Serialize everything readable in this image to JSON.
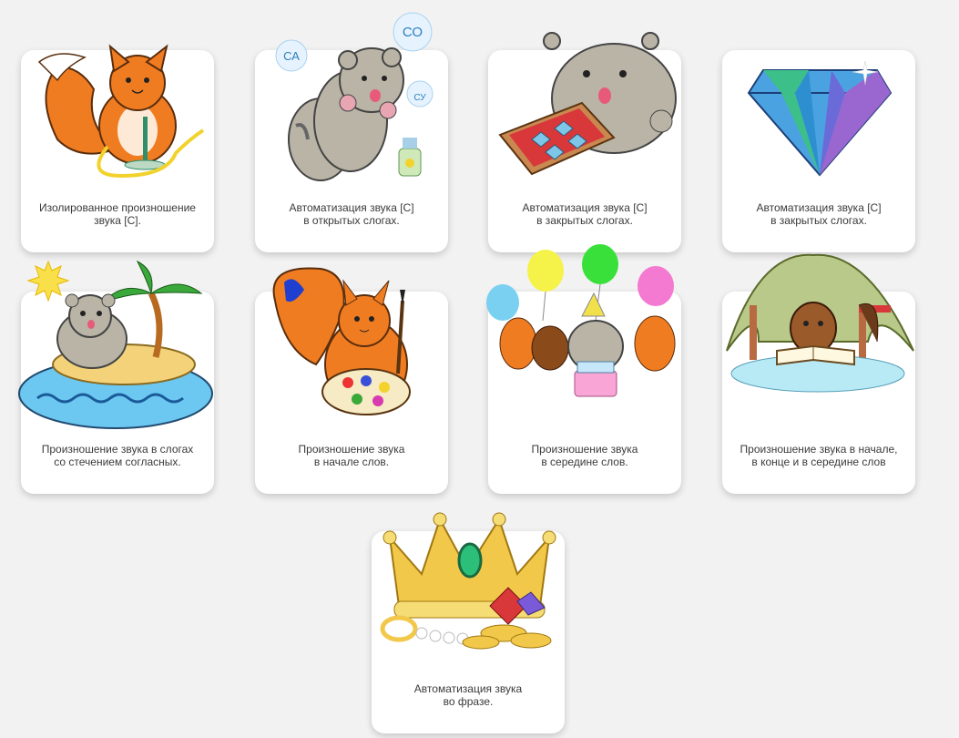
{
  "cards": [
    {
      "line1": "Изолированное произношение",
      "line2": "звука [С]."
    },
    {
      "line1": "Автоматизация звука [С]",
      "line2": "в открытых слогах."
    },
    {
      "line1": "Автоматизация звука [С]",
      "line2": "в закрытых слогах."
    },
    {
      "line1": "Автоматизация звука [С]",
      "line2": "в закрытых слогах."
    },
    {
      "line1": "Произношение звука в слогах",
      "line2": "со стечением согласных."
    },
    {
      "line1": "Произношение звука",
      "line2": "в начале слов."
    },
    {
      "line1": "Произношение звука",
      "line2": "в середине слов."
    },
    {
      "line1": "Произношение звука в начале,",
      "line2": "в конце и в середине слов"
    },
    {
      "line1": "Автоматизация звука",
      "line2": "во фразе."
    }
  ],
  "bubbles": {
    "sa": "СА",
    "so": "СО",
    "su": "СУ"
  },
  "colors": {
    "background": "#f2f2f2",
    "card": "#ffffff",
    "text": "#3a3a3a",
    "fox": "#f07c22",
    "cat": "#b9b4a6",
    "gold": "#f2c84b"
  }
}
